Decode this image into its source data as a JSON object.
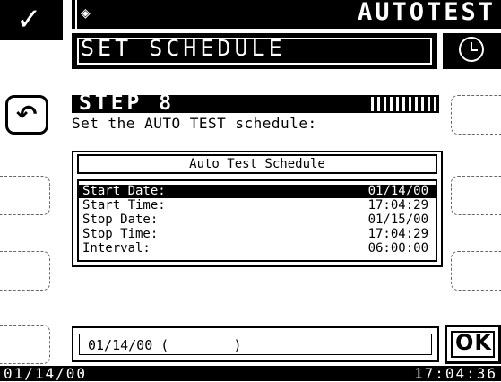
{
  "header": {
    "title": "AUTOTEST",
    "confirm_icon": "check-icon",
    "mode_icon": "diamond-icon"
  },
  "screen": {
    "title": "SET SCHEDULE",
    "clock_icon": "clock-icon"
  },
  "step": {
    "label": "STEP 8",
    "instruction": "Set the AUTO TEST schedule:"
  },
  "schedule": {
    "title": "Auto Test Schedule",
    "rows": [
      {
        "label": "Start Date:",
        "value": "01/14/00",
        "selected": true
      },
      {
        "label": "Start Time:",
        "value": "17:04:29",
        "selected": false
      },
      {
        "label": "Stop Date:",
        "value": "01/15/00",
        "selected": false
      },
      {
        "label": "Stop Time:",
        "value": "17:04:29",
        "selected": false
      },
      {
        "label": "Interval:",
        "value": "06:00:00",
        "selected": false
      }
    ]
  },
  "edit": {
    "value": "01/14/00 (        )"
  },
  "buttons": {
    "ok_label": "OK",
    "back_icon": "undo-icon"
  },
  "status": {
    "date": "01/14/00",
    "time": "17:04:36"
  },
  "colors": {
    "foreground": "#000000",
    "background": "#ffffff"
  }
}
